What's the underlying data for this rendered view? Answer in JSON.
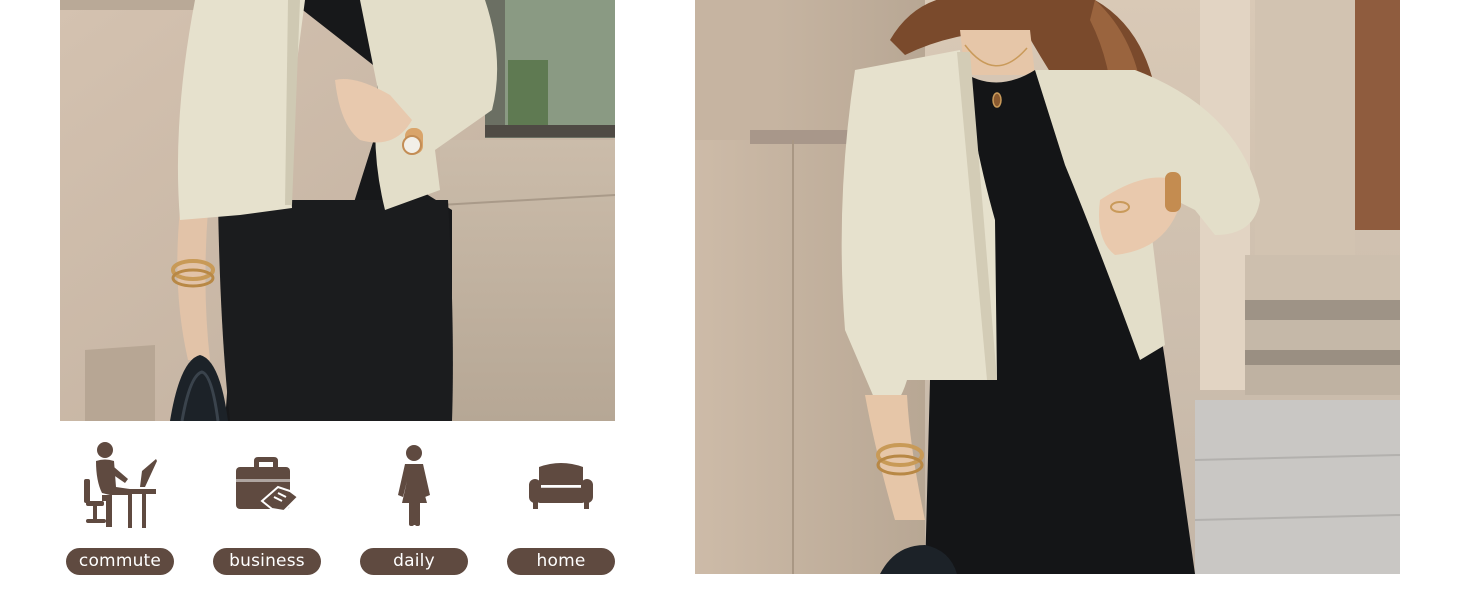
{
  "occasions": [
    {
      "label": "commute",
      "icon": "desk-worker-icon"
    },
    {
      "label": "business",
      "icon": "briefcase-handshake-icon"
    },
    {
      "label": "daily",
      "icon": "woman-figure-icon"
    },
    {
      "label": "home",
      "icon": "sofa-icon"
    }
  ],
  "colors": {
    "pill_bg": "#5f4a40",
    "icon": "#5f4a40",
    "cardigan": "#e6e1cd",
    "dress": "#161719",
    "wall": "#c9b8a6"
  }
}
